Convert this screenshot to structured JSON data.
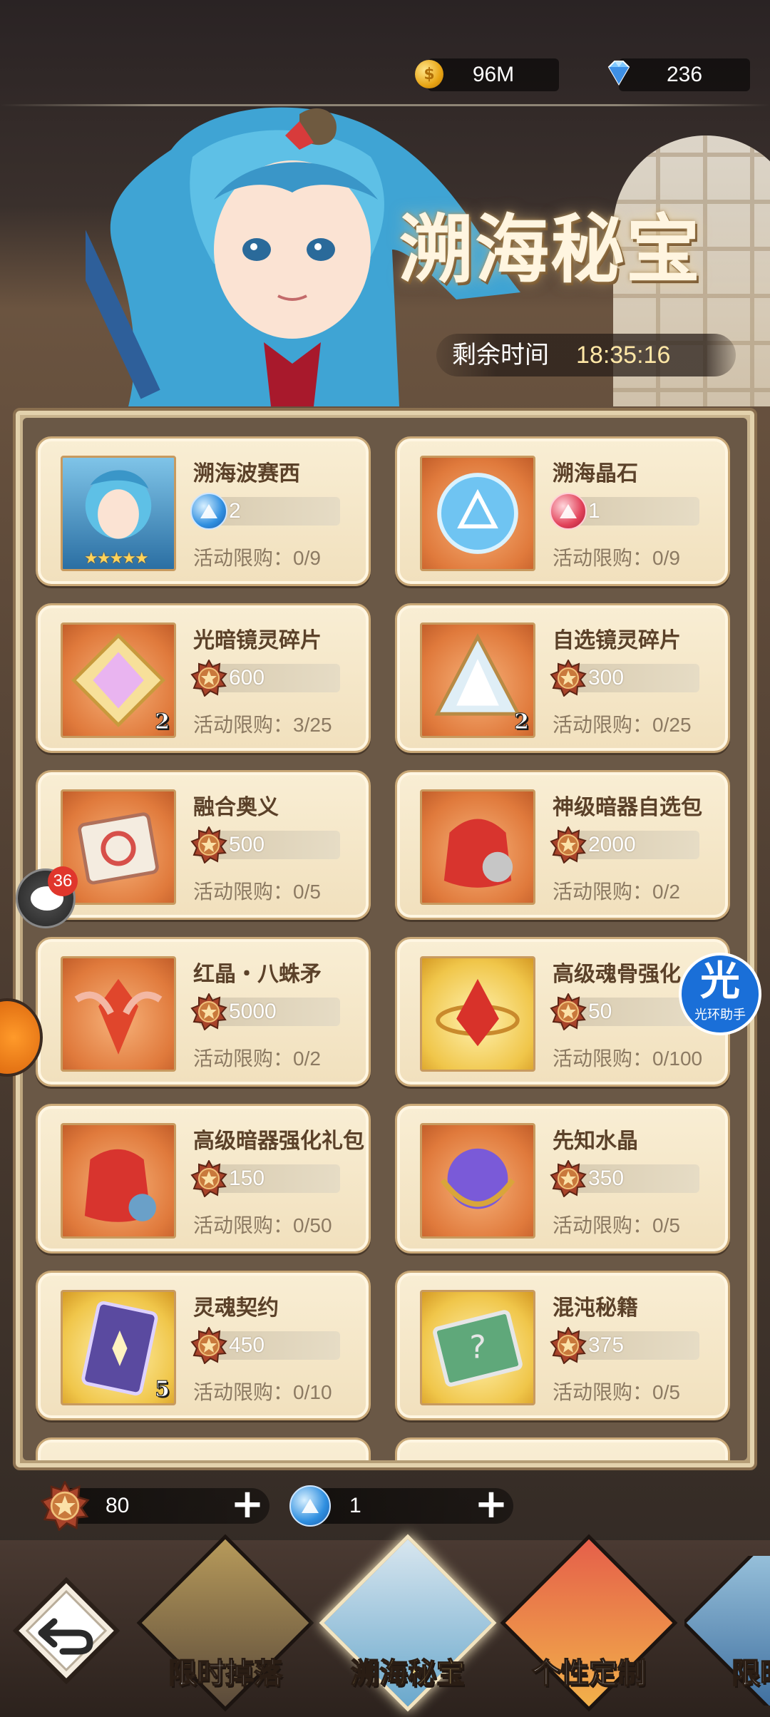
{
  "currency": {
    "gold": {
      "value": "96M",
      "icon": "gold-coin-icon"
    },
    "diamond": {
      "value": "236",
      "icon": "diamond-icon"
    }
  },
  "banner": {
    "title": "溯海秘宝",
    "timer_label": "剩余时间",
    "timer_value": "18:35:16"
  },
  "shop": {
    "limit_label": "活动限购：",
    "items": [
      {
        "name": "溯海波赛西",
        "price": "2",
        "currency_icon": "blue-orb-icon",
        "limit": "0/9",
        "qty": "",
        "stars": 5
      },
      {
        "name": "溯海晶石",
        "price": "1",
        "currency_icon": "red-orb-icon",
        "limit": "0/9",
        "qty": ""
      },
      {
        "name": "光暗镜灵碎片",
        "price": "600",
        "currency_icon": "medal-icon",
        "limit": "3/25",
        "qty": "2"
      },
      {
        "name": "自选镜灵碎片",
        "price": "300",
        "currency_icon": "medal-icon",
        "limit": "0/25",
        "qty": "2"
      },
      {
        "name": "融合奥义",
        "price": "500",
        "currency_icon": "medal-icon",
        "limit": "0/5",
        "qty": ""
      },
      {
        "name": "神级暗器自选包",
        "price": "2000",
        "currency_icon": "medal-icon",
        "limit": "0/2",
        "qty": ""
      },
      {
        "name": "红晶・八蛛矛",
        "price": "5000",
        "currency_icon": "medal-icon",
        "limit": "0/2",
        "qty": ""
      },
      {
        "name": "高级魂骨强化",
        "price": "50",
        "currency_icon": "medal-icon",
        "limit": "0/100",
        "qty": ""
      },
      {
        "name": "高级暗器强化礼包",
        "price": "150",
        "currency_icon": "medal-icon",
        "limit": "0/50",
        "qty": ""
      },
      {
        "name": "先知水晶",
        "price": "350",
        "currency_icon": "medal-icon",
        "limit": "0/5",
        "qty": ""
      },
      {
        "name": "灵魂契约",
        "price": "450",
        "currency_icon": "medal-icon",
        "limit": "0/10",
        "qty": "5"
      },
      {
        "name": "混沌秘籍",
        "price": "375",
        "currency_icon": "medal-icon",
        "limit": "0/5",
        "qty": ""
      }
    ]
  },
  "floating": {
    "chat_badge": "36",
    "helper_big": "光",
    "helper_small": "光环助手"
  },
  "resources": {
    "medal": {
      "value": "80"
    },
    "orb": {
      "value": "1"
    }
  },
  "nav": {
    "tabs": [
      {
        "label": "限时掉落",
        "active": false
      },
      {
        "label": "溯海秘宝",
        "active": true
      },
      {
        "label": "个性定制",
        "active": false
      },
      {
        "label": "限时",
        "active": false
      }
    ]
  },
  "colors": {
    "card_bg": "#f6e8c9",
    "title_text": "#5b4129",
    "active_tab": "#ffe38a"
  }
}
